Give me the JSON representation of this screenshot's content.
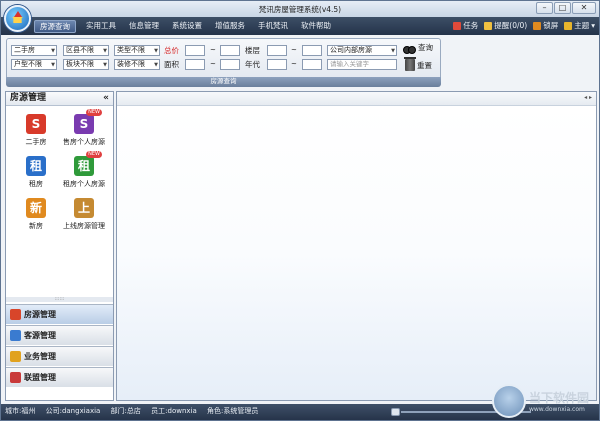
{
  "app": {
    "title": "梵讯房屋管理系统(v4.5)"
  },
  "window_buttons": {
    "minimize": "–",
    "restore": "□",
    "close": "✕"
  },
  "menu": [
    {
      "label": "房源查询",
      "active": true
    },
    {
      "label": "实用工具"
    },
    {
      "label": "信息管理"
    },
    {
      "label": "系统设置"
    },
    {
      "label": "增值服务"
    },
    {
      "label": "手机梵讯"
    },
    {
      "label": "软件帮助"
    }
  ],
  "right_menu": {
    "task": "任务",
    "reminder": "提醒(0/0)",
    "lock": "锁屏",
    "theme": "主题"
  },
  "filters": {
    "row1": [
      "二手房",
      "区县不限",
      "类型不限"
    ],
    "row2": [
      "户型不限",
      "板块不限",
      "装修不限"
    ],
    "total_price_label": "总价",
    "area_label": "面积",
    "floor_label": "楼层",
    "year_label": "年代",
    "tilde": "~",
    "source_select": "公司内部房源",
    "keyword_placeholder": "请输入关键字",
    "search_label": "查询",
    "reset_label": "重置",
    "footer": "房源查询"
  },
  "sidebar": {
    "title": "房源管理",
    "collapse": "«",
    "items": [
      {
        "label": "二手房",
        "icon": "house-sale-icon",
        "color": "#d83a2a",
        "glyph": "S"
      },
      {
        "label": "售房个人房源",
        "icon": "personal-sale-icon",
        "color": "#7a3bb0",
        "glyph": "S",
        "badge": "NEW"
      },
      {
        "label": "租房",
        "icon": "rent-icon",
        "color": "#2a6fc9",
        "glyph": "租"
      },
      {
        "label": "租房个人房源",
        "icon": "personal-rent-icon",
        "color": "#2f9a3a",
        "glyph": "租",
        "badge": "NEW"
      },
      {
        "label": "新房",
        "icon": "new-house-icon",
        "color": "#e08a1f",
        "glyph": "新"
      },
      {
        "label": "上线房源管理",
        "icon": "online-listing-icon",
        "color": "#c58a32",
        "glyph": "上"
      }
    ],
    "grip": "::::::",
    "nav": [
      {
        "label": "房源管理",
        "icon": "house-icon",
        "color": "#d8452a",
        "active": true
      },
      {
        "label": "客源管理",
        "icon": "customer-icon",
        "color": "#3a7bd0"
      },
      {
        "label": "业务管理",
        "icon": "business-icon",
        "color": "#e1a21f"
      },
      {
        "label": "联盟管理",
        "icon": "alliance-icon",
        "color": "#c93a3a"
      }
    ]
  },
  "main": {
    "pager": "◂ ▸"
  },
  "status": {
    "city": "城市:福州",
    "company": "公司:dangxiaxia",
    "dept": "部门:总店",
    "staff": "员工:downxia",
    "role": "角色:系统管理员"
  },
  "watermark": {
    "title": "当下软件园",
    "sub": "www.downxia.com"
  }
}
